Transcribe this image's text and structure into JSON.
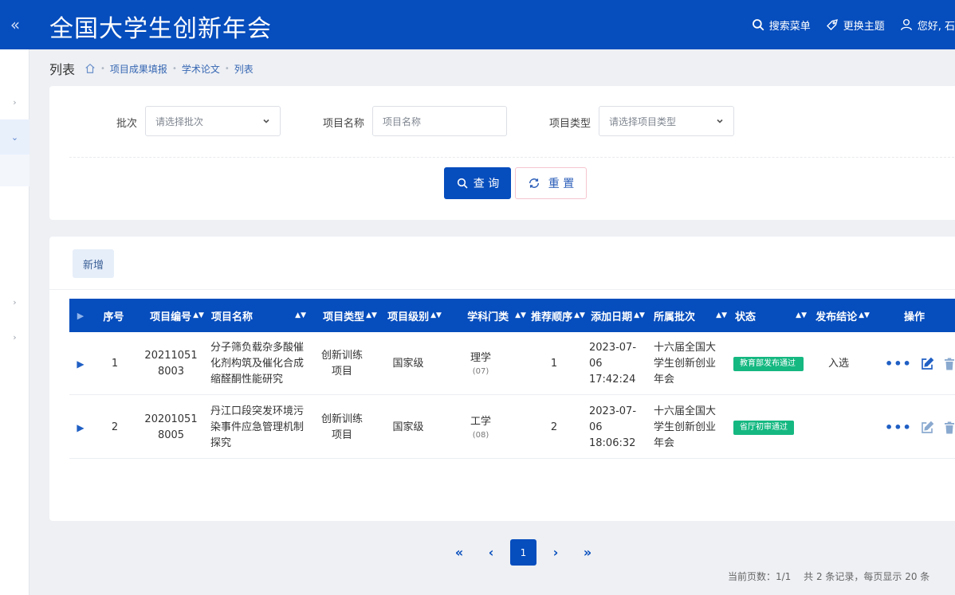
{
  "header": {
    "title": "全国大学生创新年会",
    "collapse_icon": "«",
    "search_menu": "搜索菜单",
    "change_theme": "更换主题",
    "greeting": "您好, 石"
  },
  "sidebar": {
    "chevrons": [
      "›",
      "⌄",
      "›",
      "›"
    ]
  },
  "breadcrumb": {
    "title": "列表",
    "items": [
      "项目成果填报",
      "学术论文",
      "列表"
    ],
    "separator": "•"
  },
  "search": {
    "batch_label": "批次",
    "batch_placeholder": "请选择批次",
    "name_label": "项目名称",
    "name_placeholder": "项目名称",
    "type_label": "项目类型",
    "type_placeholder": "请选择项目类型",
    "query_button": "查 询",
    "reset_button": "重 置"
  },
  "toolbar": {
    "add_button": "新增"
  },
  "table": {
    "columns": [
      "序号",
      "项目编号",
      "项目名称",
      "项目类型",
      "项目级别",
      "学科门类",
      "推荐顺序",
      "添加日期",
      "所属批次",
      "状态",
      "发布结论",
      "操作"
    ],
    "rows": [
      {
        "index": "1",
        "code_line1": "20211051",
        "code_line2": "8003",
        "name": "分子筛负载杂多酸催化剂构筑及催化合成缩醛酮性能研究",
        "type": "创新训练项目",
        "level": "国家级",
        "discipline": "理学",
        "discipline_code": "(07)",
        "order": "1",
        "date_line1": "2023-07-",
        "date_line2": "06",
        "date_line3": "17:42:24",
        "batch": "十六届全国大学生创新创业年会",
        "status": "教育部发布通过",
        "conclusion": "入选"
      },
      {
        "index": "2",
        "code_line1": "20201051",
        "code_line2": "8005",
        "name": "丹江口段突发环境污染事件应急管理机制探究",
        "type": "创新训练项目",
        "level": "国家级",
        "discipline": "工学",
        "discipline_code": "(08)",
        "order": "2",
        "date_line1": "2023-07-",
        "date_line2": "06",
        "date_line3": "18:06:32",
        "batch": "十六届全国大学生创新创业年会",
        "status": "省厅初审通过",
        "conclusion": ""
      }
    ]
  },
  "pagination": {
    "first": "«",
    "prev": "‹",
    "current": "1",
    "next": "›",
    "last": "»",
    "info": "当前页数：1/1　 共 2 条记录，每页显示 20 条"
  },
  "colors": {
    "primary": "#064dbd",
    "status_green": "#15b881"
  }
}
